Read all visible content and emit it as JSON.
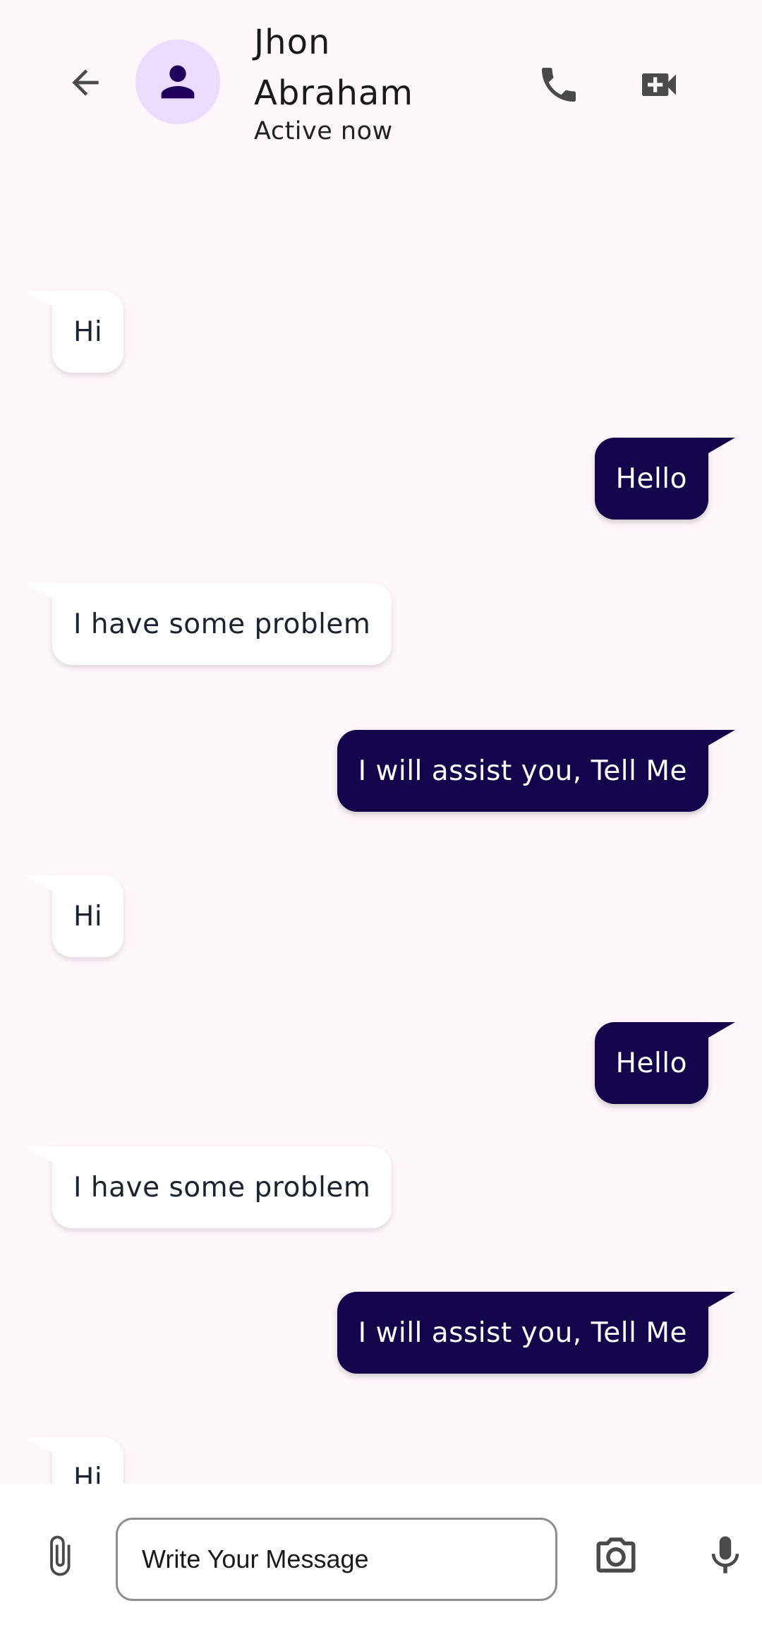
{
  "header": {
    "contact_name": "Jhon Abraham",
    "status": "Active now",
    "icons": {
      "back": "arrow-back-icon",
      "avatar": "person-icon",
      "call": "phone-icon",
      "video": "video-call-icon"
    }
  },
  "messages": [
    {
      "direction": "in",
      "text": "Hi"
    },
    {
      "direction": "out",
      "text": "Hello"
    },
    {
      "direction": "in",
      "text": "I have some problem"
    },
    {
      "direction": "out",
      "text": "I will assist you, Tell Me"
    },
    {
      "direction": "in",
      "text": "Hi"
    },
    {
      "direction": "out",
      "text": "Hello"
    },
    {
      "direction": "in",
      "text": "I have some problem"
    },
    {
      "direction": "out",
      "text": "I will assist you, Tell Me"
    },
    {
      "direction": "in",
      "text": "Hi"
    }
  ],
  "composer": {
    "placeholder": "Write Your Message",
    "value": "",
    "icons": {
      "attach": "paperclip-icon",
      "camera": "camera-icon",
      "mic": "microphone-icon"
    }
  },
  "colors": {
    "background": "#fdf6fb",
    "incoming_bubble": "#ffffff",
    "outgoing_bubble": "#13044b",
    "avatar_bg": "#eaddff",
    "icon": "#4a4a4a"
  }
}
